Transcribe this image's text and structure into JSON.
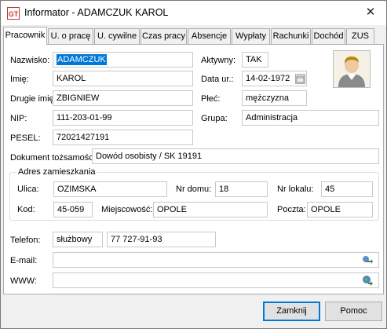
{
  "window": {
    "title": "Informator - ADAMCZUK KAROL"
  },
  "tabs": [
    {
      "label": "Pracownik",
      "active": true
    },
    {
      "label": "U. o pracę",
      "active": false
    },
    {
      "label": "U. cywilne",
      "active": false
    },
    {
      "label": "Czas pracy",
      "active": false
    },
    {
      "label": "Absencje",
      "active": false
    },
    {
      "label": "Wypłaty",
      "active": false
    },
    {
      "label": "Rachunki",
      "active": false
    },
    {
      "label": "Dochód",
      "active": false
    },
    {
      "label": "ZUS",
      "active": false
    }
  ],
  "employee": {
    "surname_label": "Nazwisko:",
    "surname": "ADAMCZUK",
    "firstname_label": "Imię:",
    "firstname": "KAROL",
    "second_name_label": "Drugie imię:",
    "second_name": "ZBIGNIEW",
    "nip_label": "NIP:",
    "nip": "111-203-01-99",
    "pesel_label": "PESEL:",
    "pesel": "72021427191",
    "active_label": "Aktywny:",
    "active": "TAK",
    "birth_label": "Data ur.:",
    "birth": "14-02-1972",
    "sex_label": "Płeć:",
    "sex": "mężczyzna",
    "group_label": "Grupa:",
    "group": "Administracja",
    "id_doc_label": "Dokument tożsamości:",
    "id_doc": "Dowód osobisty / SK 19191"
  },
  "address": {
    "group_title": "Adres zamieszkania",
    "street_label": "Ulica:",
    "street": "OZIMSKA",
    "house_label": "Nr domu:",
    "house": "18",
    "flat_label": "Nr lokalu:",
    "flat": "45",
    "postcode_label": "Kod:",
    "postcode": "45-059",
    "city_label": "Miejscowość:",
    "city": "OPOLE",
    "post_label": "Poczta:",
    "post": "OPOLE"
  },
  "contact": {
    "phone_label": "Telefon:",
    "phone_type": "służbowy",
    "phone": "77 727-91-93",
    "email_label": "E-mail:",
    "email": "",
    "www_label": "WWW:",
    "www": ""
  },
  "buttons": {
    "close": "Zamknij",
    "help": "Pomoc"
  },
  "icons": {
    "app": "app-logo-icon",
    "close": "close-icon",
    "photo": "employee-photo",
    "calendar": "calendar-icon",
    "email_go": "send-email-icon",
    "www_go": "open-web-icon"
  }
}
